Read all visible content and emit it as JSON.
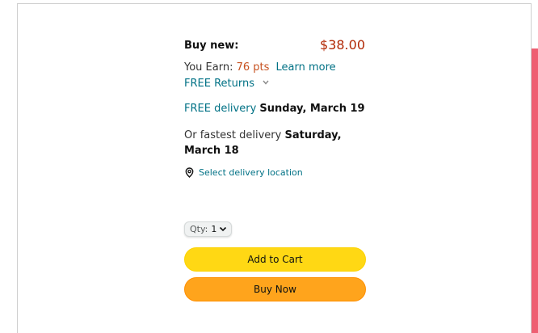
{
  "buybox": {
    "buy_new_label": "Buy new:",
    "price": "$38.00",
    "earn_prefix": "You Earn: ",
    "earn_points": "76 pts",
    "learn_more": "Learn more",
    "free_returns": "FREE Returns",
    "delivery_prefix": "FREE delivery",
    "delivery_date": "Sunday, March 19",
    "fastest_prefix": "Or fastest delivery",
    "fastest_date": "Saturday, March 18",
    "select_location": "Select delivery location",
    "qty_label": "Qty:",
    "qty_value": "1",
    "add_to_cart": "Add to Cart",
    "buy_now": "Buy Now"
  },
  "colors": {
    "price": "#b12704",
    "points": "#c7511f",
    "link": "#007185",
    "add_to_cart": "#ffd814",
    "buy_now": "#ffa41c",
    "accent_strip": "#ee5f72"
  },
  "icons": {
    "returns_chevron": "chevron-down-icon",
    "location": "location-pin-icon",
    "qty_chevron": "chevron-down-icon"
  }
}
